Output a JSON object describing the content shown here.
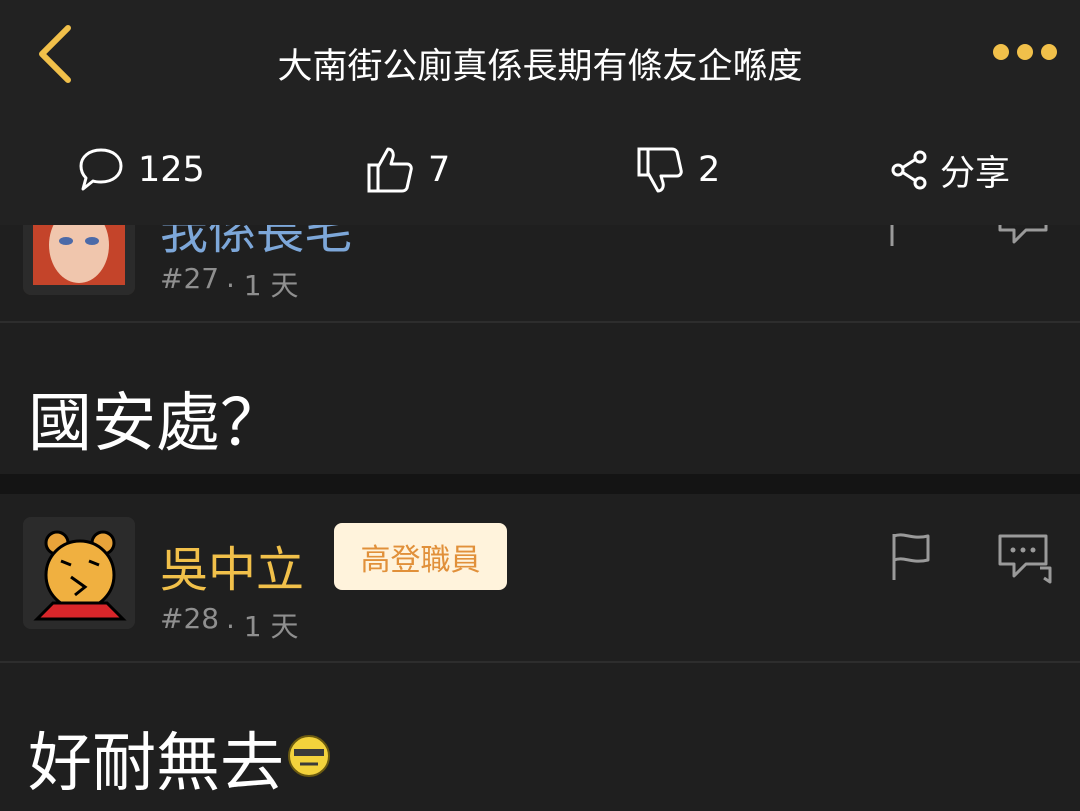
{
  "header": {
    "title": "大南街公廁真係長期有條友企喺度"
  },
  "stats": {
    "comments": "125",
    "likes": "7",
    "dislikes": "2",
    "share_label": "分享"
  },
  "posts": [
    {
      "username": "我係長毛",
      "number": "#27",
      "time": "· 1 天",
      "body": "國安處？"
    },
    {
      "username": "吳中立",
      "badge": "高登職員",
      "number": "#28",
      "time": "· 1 天",
      "body": "好耐無去"
    }
  ],
  "colors": {
    "accent": "#f1c04a",
    "background": "#1f1f1f",
    "header": "#222222",
    "badge_bg": "#fff3dc",
    "badge_text": "#e1903a",
    "partial_username": "#7da7d9"
  }
}
